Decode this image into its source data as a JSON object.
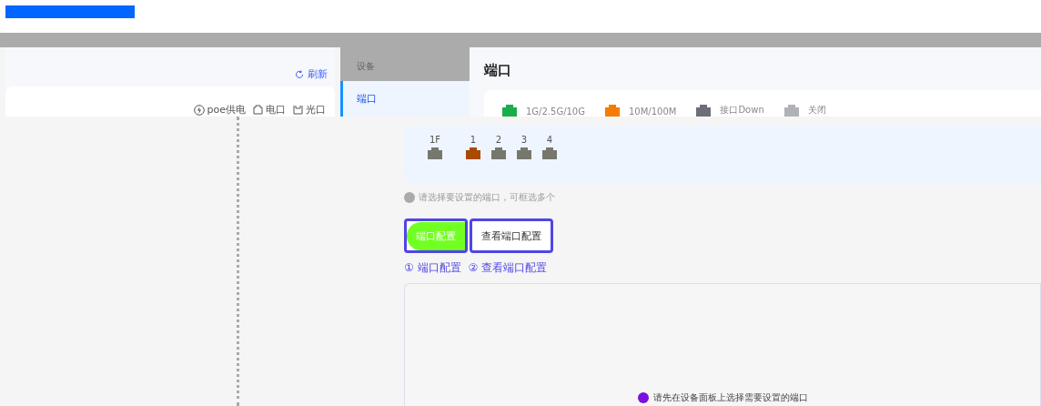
{
  "left_panel": {
    "refresh": "刷新",
    "legend": [
      {
        "kind": "poe",
        "label": "poe供电"
      },
      {
        "kind": "copper",
        "label": "电口"
      },
      {
        "kind": "fiber",
        "label": "光口"
      }
    ]
  },
  "nav": {
    "header": "设备",
    "items": [
      {
        "label": "端口",
        "selected": true
      }
    ]
  },
  "main": {
    "title": "端口",
    "status_legend": [
      {
        "label": "1G/2.5G/10G",
        "color": "#1aad4b"
      },
      {
        "label": "10M/100M",
        "color": "#f57c00"
      },
      {
        "label": "接口Down",
        "color": "#6b6f76"
      },
      {
        "label": "关闭",
        "color": "#b0b2b6"
      }
    ],
    "ports": [
      {
        "label": "1F",
        "color": "#77776e"
      },
      {
        "label": "1",
        "color": "#a84a00"
      },
      {
        "label": "2",
        "color": "#77776e"
      },
      {
        "label": "3",
        "color": "#77776e"
      },
      {
        "label": "4",
        "color": "#77776e"
      }
    ],
    "hint": "请选择要设置的端口，可框选多个",
    "tabs": [
      {
        "label": "端口配置",
        "selected": true
      },
      {
        "label": "查看端口配置",
        "selected": false
      }
    ],
    "steps": [
      "① 端口配置",
      "② 查看端口配置"
    ],
    "notice": "请先在设备面板上选择需要设置的端口"
  }
}
